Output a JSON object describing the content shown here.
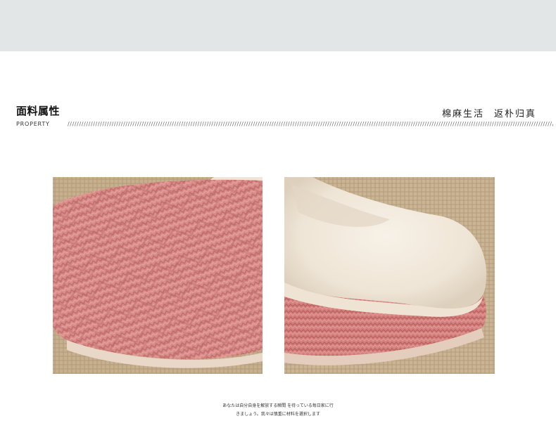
{
  "header": {
    "title_zh": "面料属性",
    "title_en": "PROPERTY",
    "slogan_part1": "棉麻生活",
    "slogan_part2": "返朴归真",
    "rule_text": "//////////////////////////////////////////////////////////////////////////////////////////////////////////////////////////////////////////////////////////////////////////////////////////////////////////////////////"
  },
  "caption": {
    "line1": "あなたは自分自身を解放する瞬間 を待っている毎日家に行",
    "line2": "きましょう。我々は慎重に材料を選択します"
  },
  "colors": {
    "top_band": "#e3e6e7",
    "knit_pink": "#d98b88",
    "fleece_cream": "#f3ece1",
    "burlap": "#c8b394"
  }
}
